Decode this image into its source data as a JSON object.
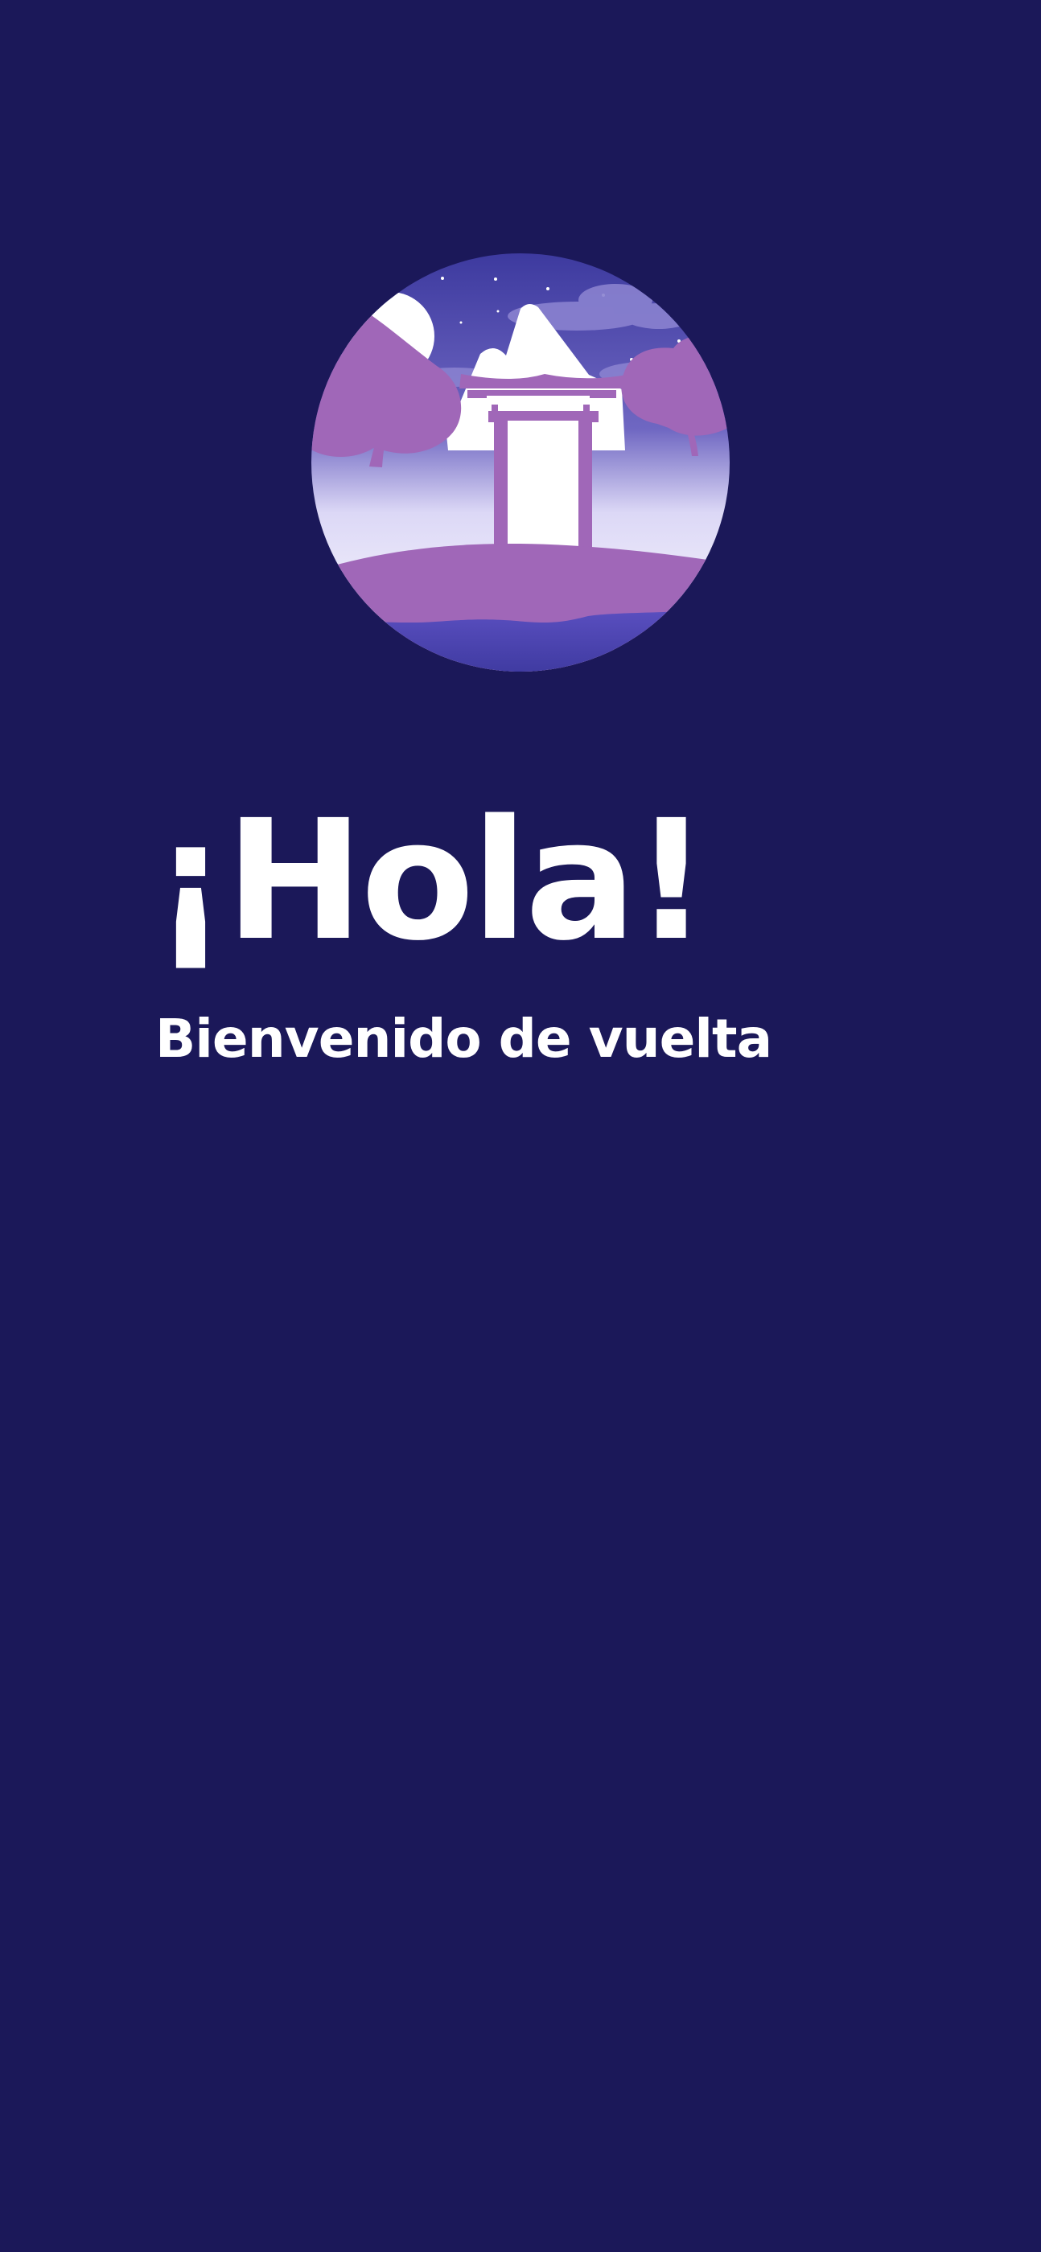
{
  "welcome": {
    "greeting": "¡Hola!",
    "subtitle": "Bienvenido de vuelta"
  },
  "hero": {
    "illustration": "temple-landscape-illustration"
  },
  "colors": {
    "background": "#1b1859",
    "primary_text": "#ffffff",
    "accent_purple": "#a067b8",
    "sky_blue": "#4b48a8"
  }
}
